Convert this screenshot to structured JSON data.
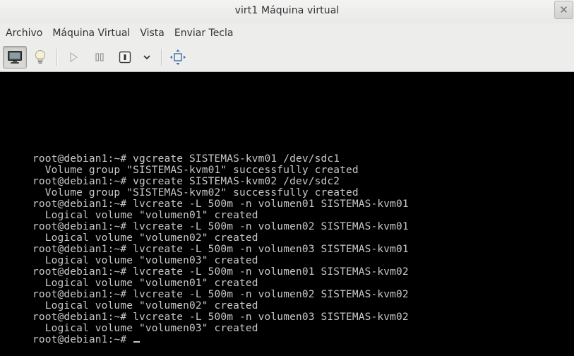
{
  "window": {
    "title": "virt1 Máquina virtual",
    "close_glyph": "✕"
  },
  "menubar": {
    "items": [
      "Archivo",
      "Máquina Virtual",
      "Vista",
      "Enviar Tecla"
    ]
  },
  "toolbar": {
    "buttons": [
      {
        "name": "console-view",
        "icon": "monitor-icon",
        "active": true
      },
      {
        "name": "details-view",
        "icon": "lightbulb-icon",
        "active": false
      },
      {
        "name": "run",
        "icon": "play-icon",
        "active": false
      },
      {
        "name": "pause",
        "icon": "pause-icon",
        "active": false
      },
      {
        "name": "shutdown",
        "icon": "power-icon",
        "active": false
      },
      {
        "name": "shutdown-menu",
        "icon": "chevron-down-icon",
        "active": false
      },
      {
        "name": "fullscreen",
        "icon": "fullscreen-icon",
        "active": false
      }
    ]
  },
  "terminal": {
    "text_color": "#c8c8c8",
    "background": "#000000",
    "lines": [
      "root@debian1:~# vgcreate SISTEMAS-kvm01 /dev/sdc1",
      "  Volume group \"SISTEMAS-kvm01\" successfully created",
      "root@debian1:~# vgcreate SISTEMAS-kvm02 /dev/sdc2",
      "  Volume group \"SISTEMAS-kvm02\" successfully created",
      "root@debian1:~# lvcreate -L 500m -n volumen01 SISTEMAS-kvm01",
      "  Logical volume \"volumen01\" created",
      "root@debian1:~# lvcreate -L 500m -n volumen02 SISTEMAS-kvm01",
      "  Logical volume \"volumen02\" created",
      "root@debian1:~# lvcreate -L 500m -n volumen03 SISTEMAS-kvm01",
      "  Logical volume \"volumen03\" created",
      "root@debian1:~# lvcreate -L 500m -n volumen01 SISTEMAS-kvm02",
      "  Logical volume \"volumen01\" created",
      "root@debian1:~# lvcreate -L 500m -n volumen02 SISTEMAS-kvm02",
      "  Logical volume \"volumen02\" created",
      "root@debian1:~# lvcreate -L 500m -n volumen03 SISTEMAS-kvm02",
      "  Logical volume \"volumen03\" created"
    ],
    "prompt": "root@debian1:~# "
  }
}
